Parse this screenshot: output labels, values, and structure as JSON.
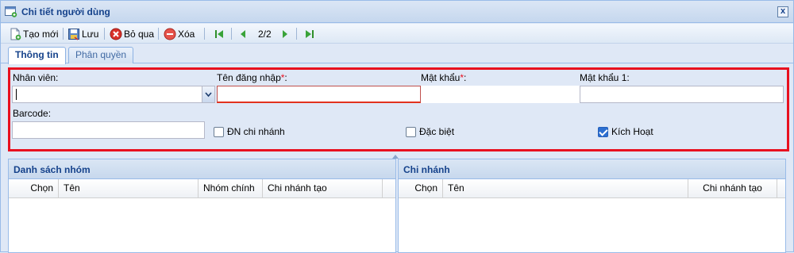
{
  "window": {
    "title": "Chi tiết người dùng",
    "close_label": "x"
  },
  "toolbar": {
    "new_label": "Tạo mới",
    "save_label": "Lưu",
    "cancel_label": "Bỏ qua",
    "delete_label": "Xóa",
    "page_indicator": "2/2"
  },
  "tabs": [
    {
      "label": "Thông tin",
      "active": true
    },
    {
      "label": "Phân quyền",
      "active": false
    }
  ],
  "form": {
    "employee_label": "Nhân viên:",
    "employee_value": "",
    "username_label": "Tên đăng nhập",
    "username_value": "",
    "password_label": "Mật khẩu",
    "password_value": "",
    "password1_label": "Mật khẩu 1:",
    "password1_value": "",
    "required_mark": "*",
    "label_colon": ":",
    "barcode_label": "Barcode:",
    "barcode_value": "",
    "branch_login_label": "ĐN chi nhánh",
    "branch_login_checked": false,
    "special_label": "Đặc biệt",
    "special_checked": false,
    "active_label": "Kích Hoạt",
    "active_checked": true
  },
  "groups_grid": {
    "title": "Danh sách nhóm",
    "columns": [
      "Chọn",
      "Tên",
      "Nhóm chính",
      "Chi nhánh tạo"
    ],
    "rows": []
  },
  "branches_grid": {
    "title": "Chi nhánh",
    "columns": [
      "Chọn",
      "Tên",
      "Chi nhánh tạo"
    ],
    "rows": []
  },
  "colors": {
    "accent": "#15428b",
    "highlight_border": "#e8101f",
    "panel_bg": "#dfe8f6"
  }
}
